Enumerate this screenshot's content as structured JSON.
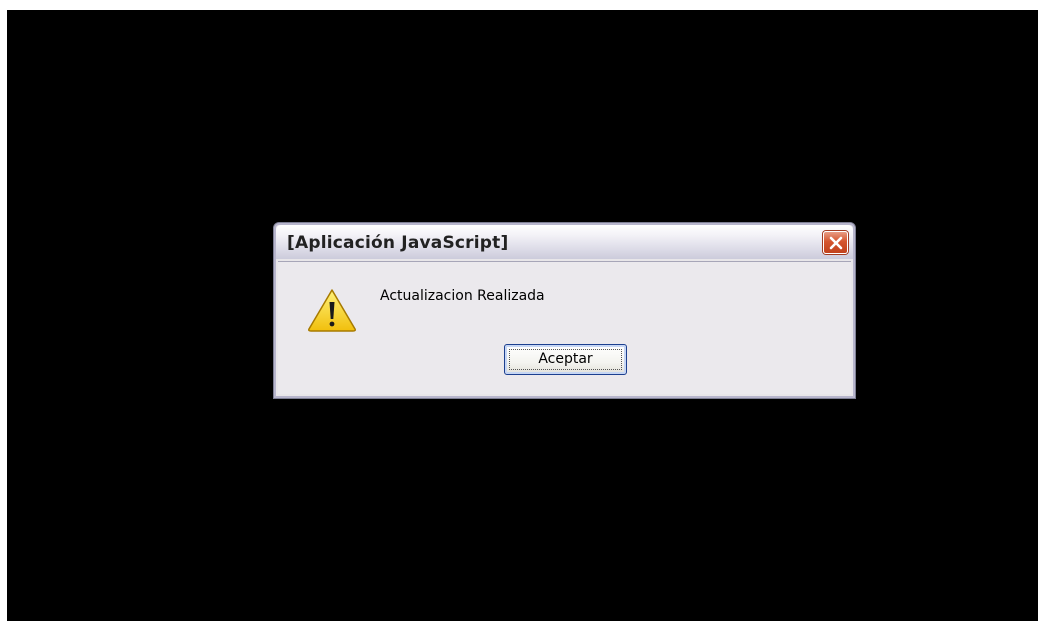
{
  "dialog": {
    "title": "[Aplicación JavaScript]",
    "message": "Actualizacion Realizada",
    "ok_label": "Aceptar",
    "icon": "warning-icon",
    "close_icon": "close-icon"
  },
  "colors": {
    "background": "#000000",
    "dialog_face": "#ebe9ed",
    "close_button": "#d5562f",
    "button_border": "#1c3f8f",
    "warning_yellow": "#f7d21a"
  }
}
